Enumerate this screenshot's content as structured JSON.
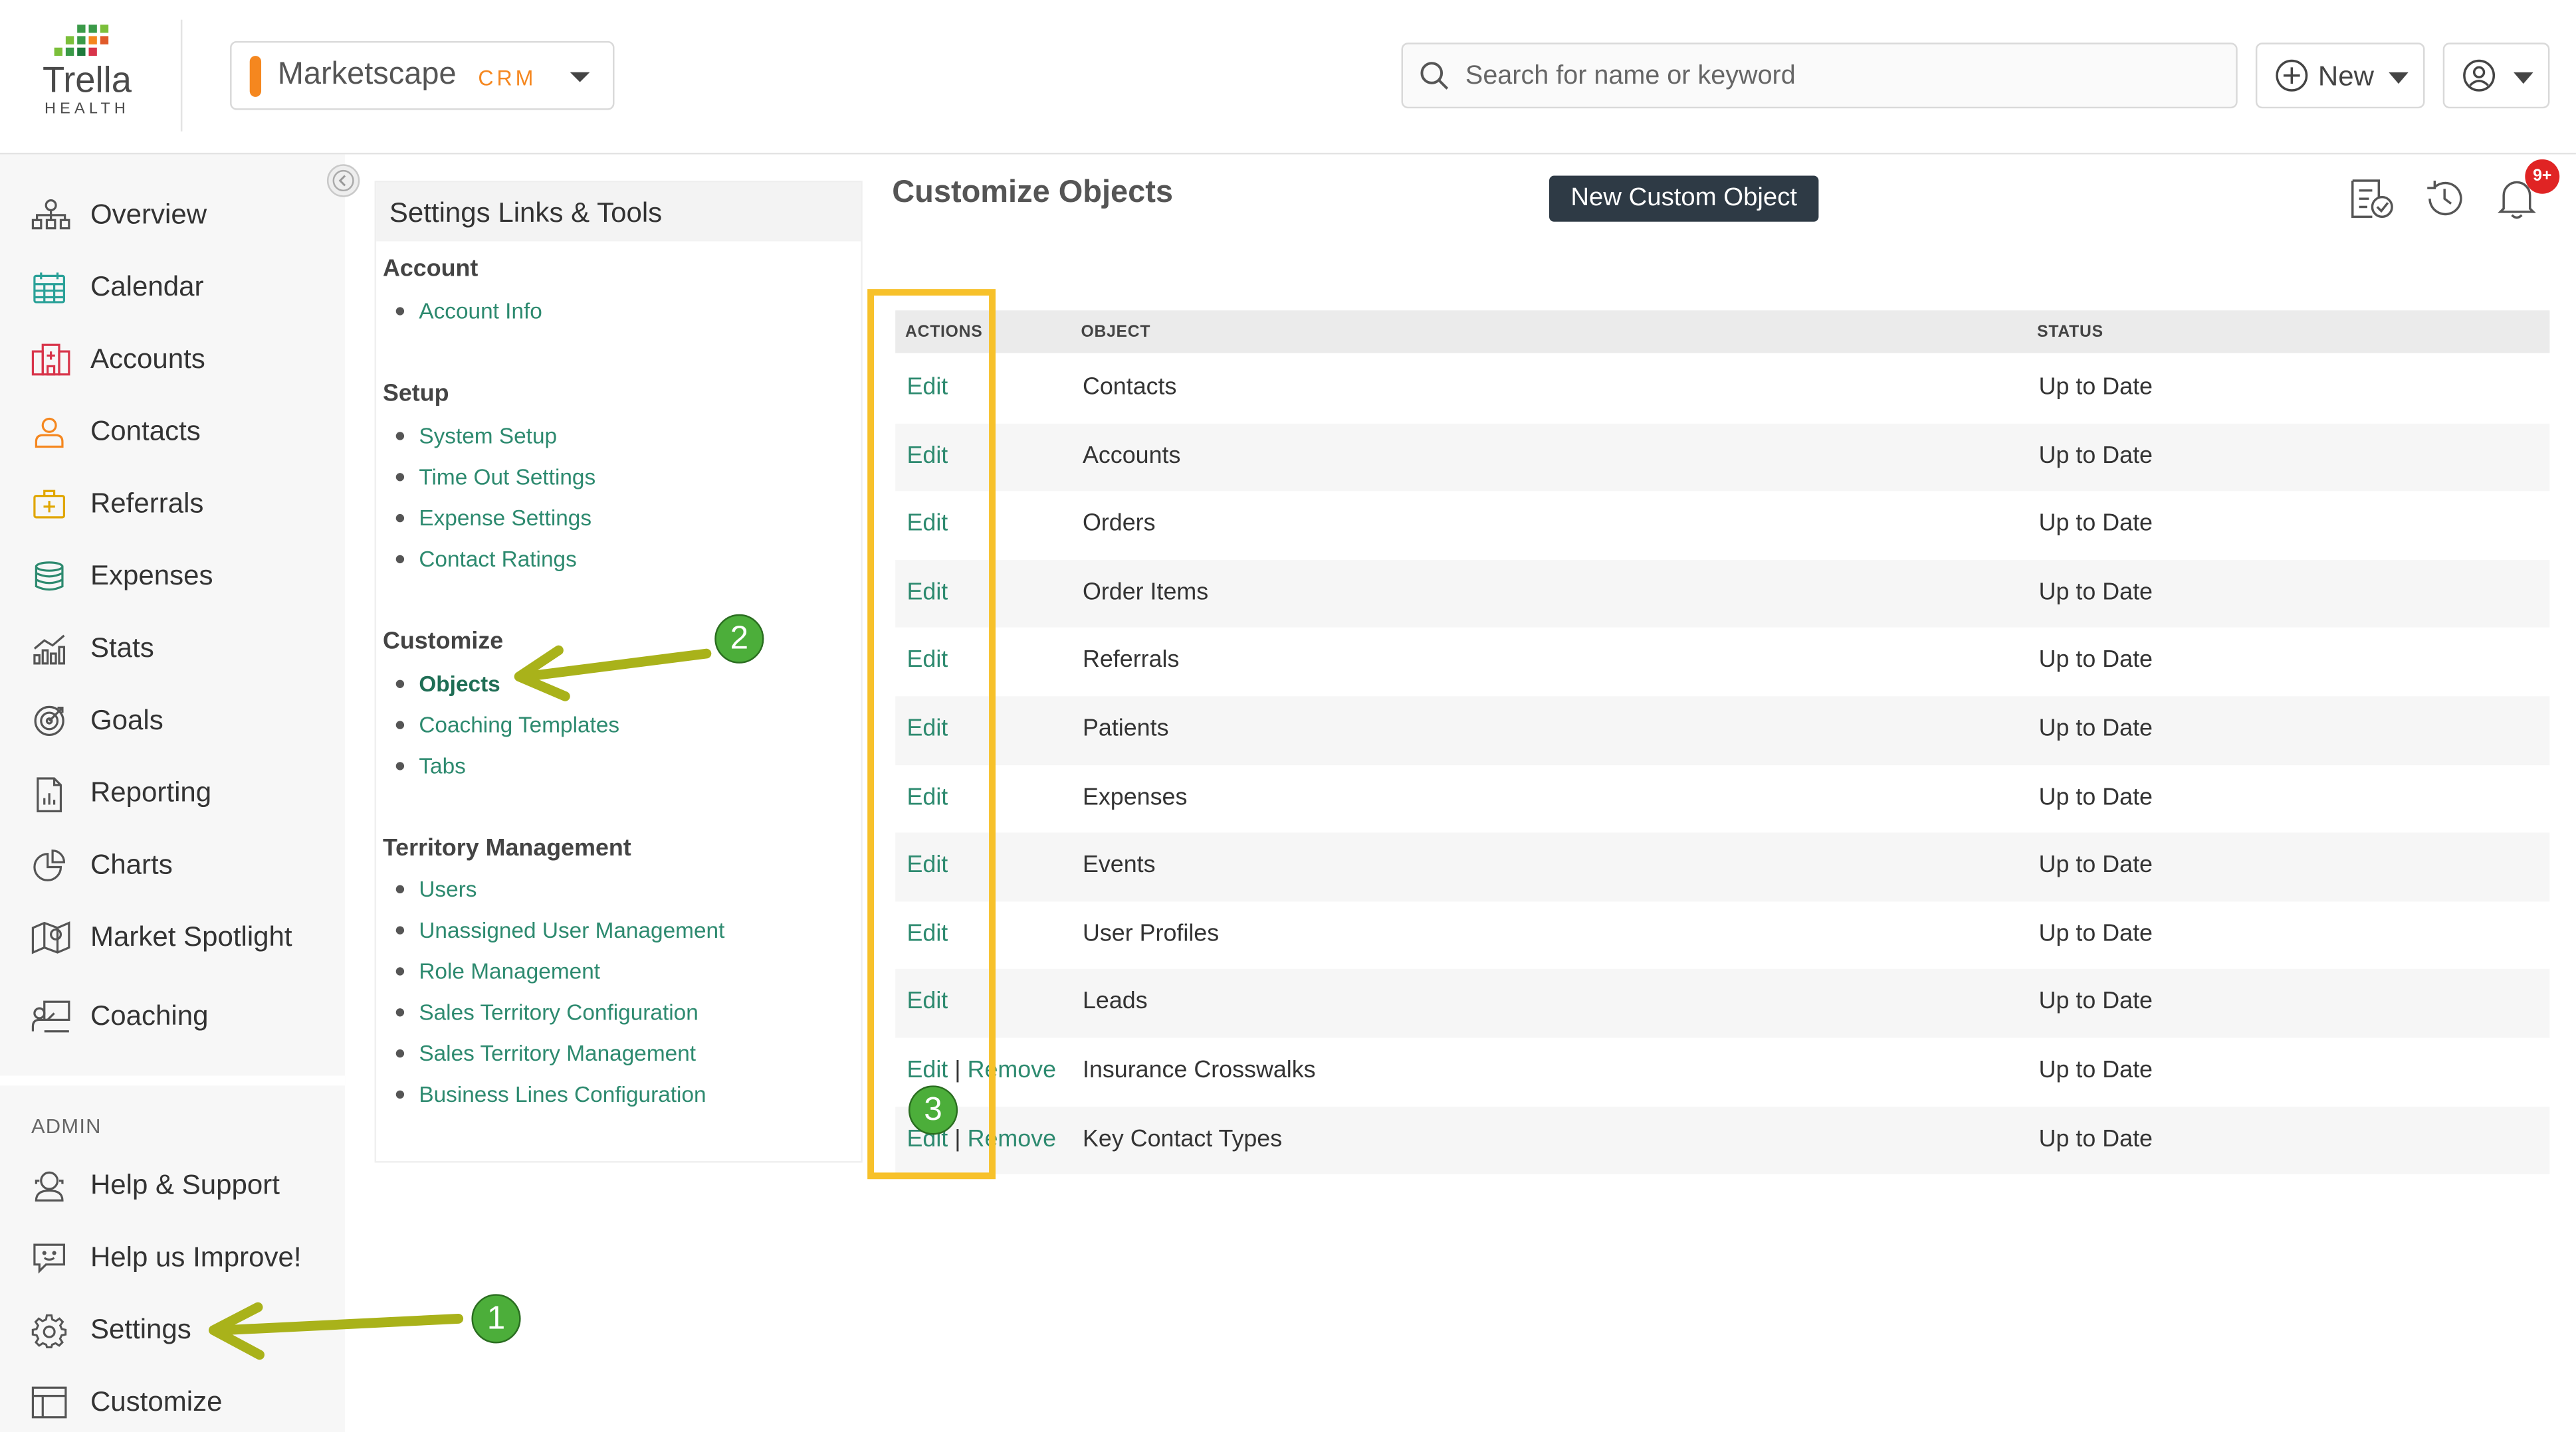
{
  "header": {
    "logo_word": "Trella",
    "logo_sub": "HEALTH",
    "app_name": "Marketscape",
    "app_suffix": "CRM",
    "search_placeholder": "Search for name or keyword",
    "new_label": "New"
  },
  "sidebar": {
    "items": [
      {
        "label": "Overview",
        "icon": "overview-icon"
      },
      {
        "label": "Calendar",
        "icon": "calendar-icon"
      },
      {
        "label": "Accounts",
        "icon": "accounts-icon"
      },
      {
        "label": "Contacts",
        "icon": "contacts-icon"
      },
      {
        "label": "Referrals",
        "icon": "referrals-icon"
      },
      {
        "label": "Expenses",
        "icon": "expenses-icon"
      },
      {
        "label": "Stats",
        "icon": "stats-icon"
      },
      {
        "label": "Goals",
        "icon": "goals-icon"
      },
      {
        "label": "Reporting",
        "icon": "reporting-icon"
      },
      {
        "label": "Charts",
        "icon": "charts-icon"
      },
      {
        "label": "Market Spotlight",
        "icon": "market-spotlight-icon"
      },
      {
        "label": "Coaching",
        "icon": "coaching-icon"
      }
    ],
    "admin_label": "ADMIN",
    "admin_items": [
      {
        "label": "Help & Support",
        "icon": "help-icon"
      },
      {
        "label": "Help us Improve!",
        "icon": "feedback-icon"
      },
      {
        "label": "Settings",
        "icon": "gear-icon"
      },
      {
        "label": "Customize",
        "icon": "customize-icon"
      }
    ]
  },
  "links_panel": {
    "title": "Settings Links & Tools",
    "sections": [
      {
        "title": "Account",
        "links": [
          "Account Info"
        ]
      },
      {
        "title": "Setup",
        "links": [
          "System Setup",
          "Time Out Settings",
          "Expense Settings",
          "Contact Ratings"
        ]
      },
      {
        "title": "Customize",
        "links": [
          "Objects",
          "Coaching Templates",
          "Tabs"
        ]
      },
      {
        "title": "Territory Management",
        "links": [
          "Users",
          "Unassigned User Management",
          "Role Management",
          "Sales Territory Configuration",
          "Sales Territory Management",
          "Business Lines Configuration"
        ]
      }
    ]
  },
  "main": {
    "title": "Customize Objects",
    "new_custom_object": "New Custom Object",
    "notification_count": "9+",
    "columns": [
      "ACTIONS",
      "OBJECT",
      "STATUS"
    ],
    "rows": [
      {
        "edit": "Edit",
        "remove": "",
        "object": "Contacts",
        "status": "Up to Date"
      },
      {
        "edit": "Edit",
        "remove": "",
        "object": "Accounts",
        "status": "Up to Date"
      },
      {
        "edit": "Edit",
        "remove": "",
        "object": "Orders",
        "status": "Up to Date"
      },
      {
        "edit": "Edit",
        "remove": "",
        "object": "Order Items",
        "status": "Up to Date"
      },
      {
        "edit": "Edit",
        "remove": "",
        "object": "Referrals",
        "status": "Up to Date"
      },
      {
        "edit": "Edit",
        "remove": "",
        "object": "Patients",
        "status": "Up to Date"
      },
      {
        "edit": "Edit",
        "remove": "",
        "object": "Expenses",
        "status": "Up to Date"
      },
      {
        "edit": "Edit",
        "remove": "",
        "object": "Events",
        "status": "Up to Date"
      },
      {
        "edit": "Edit",
        "remove": "",
        "object": "User Profiles",
        "status": "Up to Date"
      },
      {
        "edit": "Edit",
        "remove": "",
        "object": "Leads",
        "status": "Up to Date"
      },
      {
        "edit": "Edit",
        "remove": "Remove",
        "object": "Insurance Crosswalks",
        "status": "Up to Date"
      },
      {
        "edit": "Edit",
        "remove": "Remove",
        "object": "Key Contact Types",
        "status": "Up to Date"
      }
    ]
  },
  "annotations": {
    "step_labels": [
      "1",
      "2",
      "3"
    ],
    "highlight_color": "#f7c12a",
    "arrow_color": "#a9b21a",
    "step_color": "#4cae3a"
  },
  "colors": {
    "link": "#2d8a6f",
    "accent": "#f5871f",
    "dark_button": "#2e3a45",
    "badge": "#e02424"
  }
}
